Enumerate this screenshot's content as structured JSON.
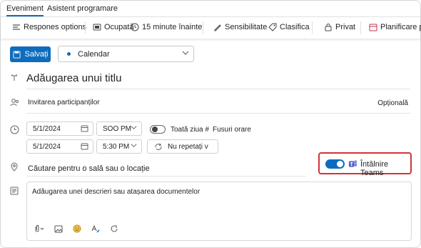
{
  "tabs": [
    "Eveniment",
    "Asistent programare"
  ],
  "toolbar": {
    "response_options": "Respones options",
    "busy": "Ocupată",
    "reminder": "15 minute înainte",
    "sensitivity": "Sensibilitate",
    "categorize": "Clasifica",
    "private": "Privat",
    "scheduling_poll": "Planificare po"
  },
  "form": {
    "save": "Salvați",
    "calendar": "Calendar",
    "title_placeholder": "Adăugarea unui titlu",
    "invite_placeholder": "Invitarea participanților",
    "optional": "Opțională",
    "start_date": "5/1/2024",
    "start_time": "SOO PM",
    "all_day": "Toată ziua #",
    "time_zones": "Fusuri orare",
    "end_date": "5/1/2024",
    "end_time": "5:30 PM",
    "repeat": "Nu repetați v",
    "location_placeholder": "Căutare pentru o sală sau o locație",
    "teams_meeting": "Întâlnire Teams",
    "teams_meeting_on": true,
    "all_day_on": false,
    "description_placeholder": "Adăugarea unei descrieri sau atașarea documentelor"
  },
  "colors": {
    "accent": "#0f6cbd",
    "highlight_border": "#d13438",
    "teams_purple": "#5b5fc7"
  },
  "icons": [
    "reply-icon",
    "busy-icon",
    "clock-icon",
    "sensitivity-icon",
    "tag-icon",
    "lock-icon",
    "poll-icon",
    "save-icon",
    "title-icon",
    "people-icon",
    "clock-row-icon",
    "calendar-icon",
    "repeat-icon",
    "location-icon",
    "teams-icon",
    "notes-icon",
    "attach-icon",
    "image-icon",
    "emoji-icon",
    "format-icon",
    "loop-icon"
  ]
}
